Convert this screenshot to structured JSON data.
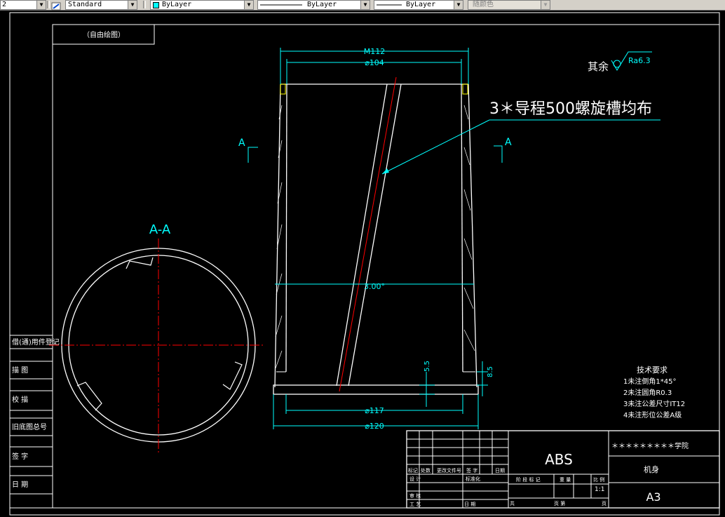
{
  "toolbar": {
    "combo1_value": "2",
    "textstyle_value": "Standard",
    "layer_value": "ByLayer",
    "linetype_value": "ByLayer",
    "lineweight_value": "ByLayer",
    "plotstyle_value": "随颜色",
    "dropdown_arrow": "▼"
  },
  "icons": {
    "text_style": "text-style-icon",
    "layer_color": "color-swatch-icon",
    "roughness": "surface-roughness-icon"
  },
  "colors": {
    "background": "#000000",
    "lines": "#ffffff",
    "dimensions": "#00ffff",
    "centerline": "#ff0000",
    "bevel": "#ffff00"
  },
  "drawing": {
    "stamp": "（自由绘图）",
    "section_label": "A-A",
    "section_mark_left": "A",
    "section_mark_right": "A",
    "dim_top_outer": "M112",
    "dim_top_inner": "⌀104",
    "dim_angle": "3.00°",
    "dim_bottom_inner": "⌀117",
    "dim_bottom_outer": "⌀120",
    "dim_thickness_left": "5.5",
    "dim_thickness_right": "8.5",
    "roughness_prefix": "其余",
    "roughness_value": "Ra6.3",
    "annotation": "3＊导程500螺旋槽均布"
  },
  "tech_requirements": {
    "title": "技术要求",
    "items": [
      "1未注倒角1*45°",
      "2未注圆角R0.3",
      "3未注公差尺寸IT12",
      "4未注形位公差A级"
    ]
  },
  "left_column": [
    "借(通)用件登记",
    "描    图",
    "校    描",
    "旧底图总号",
    "签    字",
    "日    期"
  ],
  "title_block": {
    "material": "ABS",
    "school": "＊＊＊＊＊＊＊＊＊学院",
    "part_name": "机身",
    "paper_size": "A3",
    "scale": "1:1",
    "row_headers": [
      "标记",
      "处数",
      "更改文件号",
      "签  字",
      "日期"
    ],
    "design": "设 计",
    "standardize": "标准化",
    "review": "审 核",
    "process": "工 艺",
    "date": "日 期",
    "stage_marks": "阶 段 标 记",
    "weight": "重 量",
    "ratio": "比 例",
    "sheets": "共",
    "sheet_no": "页 第",
    "page": "页"
  }
}
